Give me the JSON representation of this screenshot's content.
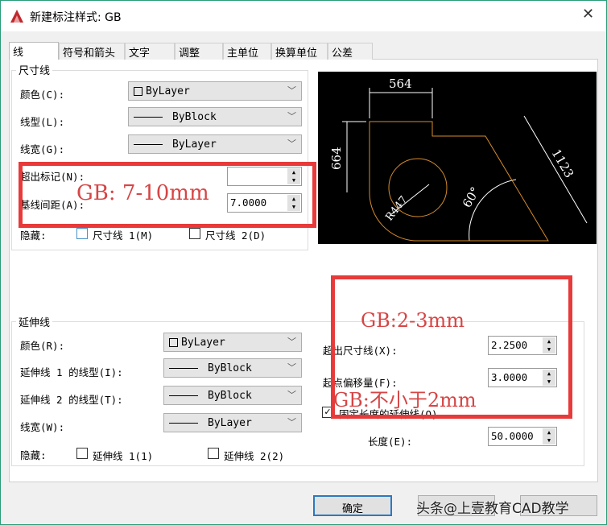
{
  "window": {
    "title": "新建标注样式: GB",
    "close": "✕"
  },
  "tabs": [
    "线",
    "符号和箭头",
    "文字",
    "调整",
    "主单位",
    "换算单位",
    "公差"
  ],
  "dim_lines": {
    "group": "尺寸线",
    "color_label": "颜色(C):",
    "color_value": "ByLayer",
    "linetype_label": "线型(L):",
    "linetype_value": "ByBlock",
    "lineweight_label": "线宽(G):",
    "lineweight_value": "ByLayer",
    "extend_ticks_label": "超出标记(N):",
    "extend_ticks_value": "",
    "baseline_label": "基线间距(A):",
    "baseline_value": "7.0000",
    "suppress_label": "隐藏:",
    "suppress1": "尺寸线 1(M)",
    "suppress2": "尺寸线 2(D)"
  },
  "preview": {
    "dim_top": "564",
    "dim_left": "664",
    "dim_diag": "1123",
    "radius": "R447",
    "angle": "60°"
  },
  "ext_lines": {
    "group": "延伸线",
    "color_label": "颜色(R):",
    "color_value": "ByLayer",
    "lt1_label": "延伸线 1 的线型(I):",
    "lt1_value": "ByBlock",
    "lt2_label": "延伸线 2 的线型(T):",
    "lt2_value": "ByBlock",
    "lw_label": "线宽(W):",
    "lw_value": "ByLayer",
    "suppress_label": "隐藏:",
    "suppress1": "延伸线 1(1)",
    "suppress2": "延伸线 2(2)",
    "extend_label": "超出尺寸线(X):",
    "extend_value": "2.2500",
    "offset_label": "起点偏移量(F):",
    "offset_value": "3.0000",
    "fixed_label": "固定长度的延伸线(O)",
    "length_label": "长度(E):",
    "length_value": "50.0000"
  },
  "annotations": {
    "a1": "GB:  7-10mm",
    "a2": "GB:2-3mm",
    "a3": "GB:不小于2mm"
  },
  "buttons": {
    "ok": "确定"
  },
  "watermark": "头条@上壹教育CAD教学"
}
